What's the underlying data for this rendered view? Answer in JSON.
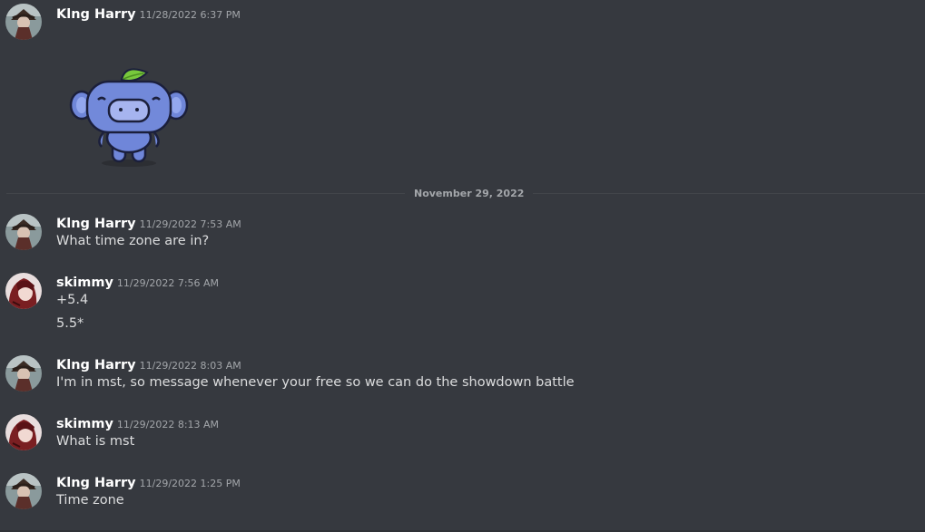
{
  "users": {
    "king": "Klng Harry",
    "skimmy": "skimmy"
  },
  "messages": [
    {
      "author": "Klng Harry",
      "timestamp": "11/28/2022 6:37 PM",
      "lines": [],
      "sticker": "wumpus-sticker"
    },
    {
      "author": "Klng Harry",
      "timestamp": "11/29/2022 7:53 AM",
      "lines": [
        "What time zone are in?"
      ]
    },
    {
      "author": "skimmy",
      "timestamp": "11/29/2022 7:56 AM",
      "lines": [
        "+5.4",
        "5.5*"
      ]
    },
    {
      "author": "Klng Harry",
      "timestamp": "11/29/2022 8:03 AM",
      "lines": [
        "I'm in mst, so message whenever your free so we can do the showdown battle"
      ]
    },
    {
      "author": "skimmy",
      "timestamp": "11/29/2022 8:13 AM",
      "lines": [
        "What is mst"
      ]
    },
    {
      "author": "Klng Harry",
      "timestamp": "11/29/2022 1:25 PM",
      "lines": [
        "Time zone"
      ]
    }
  ],
  "date_divider": "November 29, 2022",
  "colors": {
    "background": "#36393f",
    "username": "#ffffff",
    "timestamp": "#a3a6aa",
    "message_text": "#dcddde",
    "divider": "#42454a",
    "wumpus": "#7289da"
  }
}
